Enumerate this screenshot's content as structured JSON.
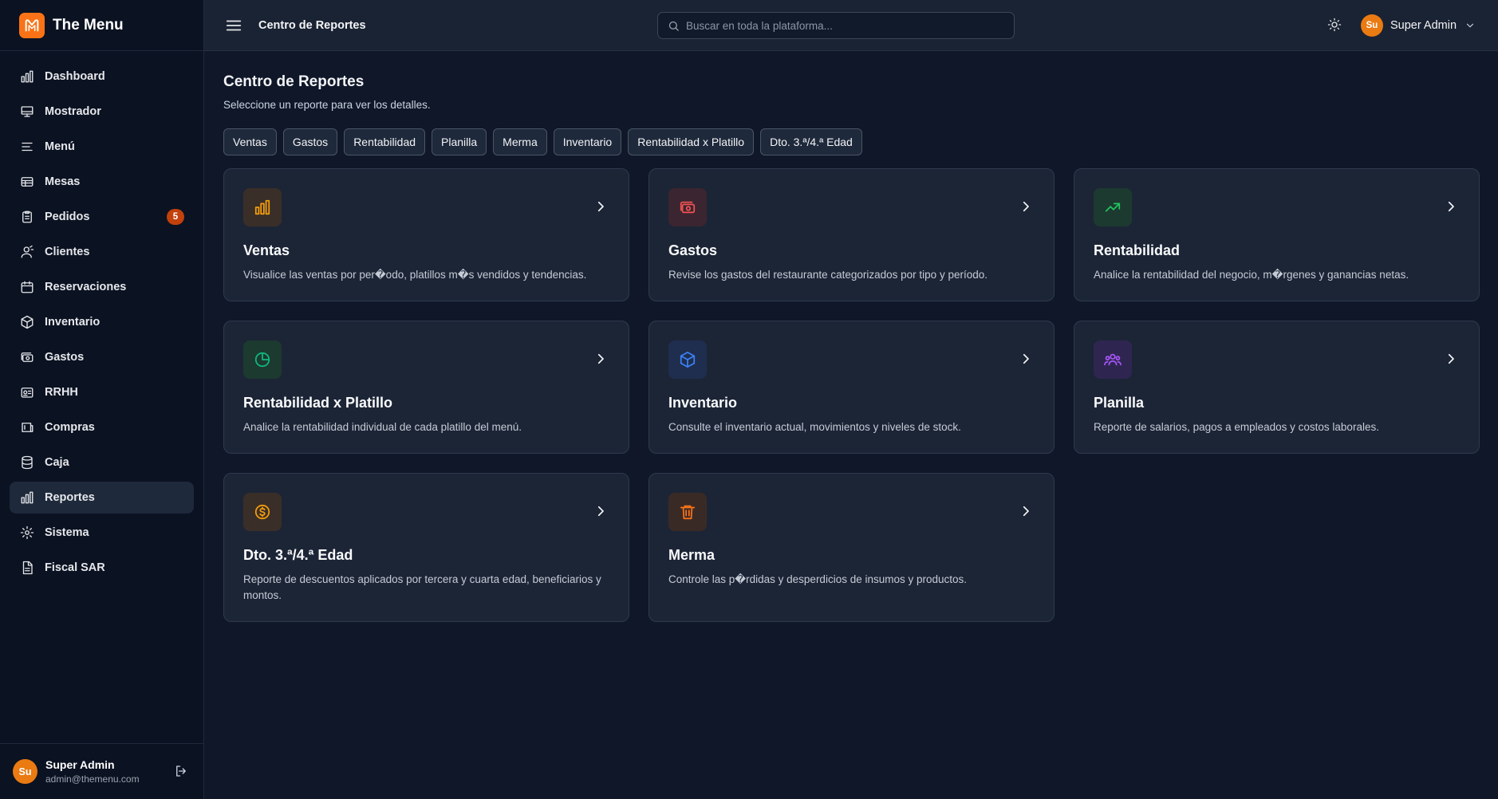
{
  "brand": {
    "name": "The Menu",
    "logo_icon": "the-menu-logo"
  },
  "sidebar": {
    "items": [
      {
        "label": "Dashboard",
        "icon": "bar-chart-icon"
      },
      {
        "label": "Mostrador",
        "icon": "monitor-icon"
      },
      {
        "label": "Menú",
        "icon": "menu-lines-icon"
      },
      {
        "label": "Mesas",
        "icon": "table-icon"
      },
      {
        "label": "Pedidos",
        "icon": "clipboard-icon",
        "badge": "5"
      },
      {
        "label": "Clientes",
        "icon": "users-icon"
      },
      {
        "label": "Reservaciones",
        "icon": "calendar-icon"
      },
      {
        "label": "Inventario",
        "icon": "box-icon"
      },
      {
        "label": "Gastos",
        "icon": "banknote-icon"
      },
      {
        "label": "RRHH",
        "icon": "id-card-icon"
      },
      {
        "label": "Compras",
        "icon": "cart-icon"
      },
      {
        "label": "Caja",
        "icon": "database-icon"
      },
      {
        "label": "Reportes",
        "icon": "bar-chart-icon",
        "active": true
      },
      {
        "label": "Sistema",
        "icon": "settings-icon"
      },
      {
        "label": "Fiscal SAR",
        "icon": "file-icon"
      }
    ],
    "user": {
      "initials": "Su",
      "name": "Super Admin",
      "email": "admin@themenu.com"
    }
  },
  "header": {
    "title": "Centro de Reportes",
    "search_placeholder": "Buscar en toda la plataforma...",
    "user": {
      "initials": "Su",
      "name": "Super Admin"
    }
  },
  "main": {
    "title": "Centro de Reportes",
    "subtitle": "Seleccione un reporte para ver los detalles.",
    "tabs": [
      "Ventas",
      "Gastos",
      "Rentabilidad",
      "Planilla",
      "Merma",
      "Inventario",
      "Rentabilidad x Platillo",
      "Dto. 3.ª/4.ª Edad"
    ],
    "cards": [
      {
        "title": "Ventas",
        "desc": "Visualice las ventas por per�odo, platillos m�s vendidos y tendencias.",
        "icon": "bar-chart-icon",
        "color": "#f59e0b",
        "bg": "#3a2e28"
      },
      {
        "title": "Gastos",
        "desc": "Revise los gastos del restaurante categorizados por tipo y período.",
        "icon": "banknote-icon",
        "color": "#f05252",
        "bg": "#3b2530"
      },
      {
        "title": "Rentabilidad",
        "desc": "Analice la rentabilidad del negocio, m�rgenes y ganancias netas.",
        "icon": "trending-up-icon",
        "color": "#22c55e",
        "bg": "#1c3a30"
      },
      {
        "title": "Rentabilidad x Platillo",
        "desc": "Analice la rentabilidad individual de cada platillo del menú.",
        "icon": "pie-chart-icon",
        "color": "#10b981",
        "bg": "#1c3a30"
      },
      {
        "title": "Inventario",
        "desc": "Consulte el inventario actual, movimientos y niveles de stock.",
        "icon": "box-icon",
        "color": "#3b82f6",
        "bg": "#1f2e4e"
      },
      {
        "title": "Planilla",
        "desc": "Reporte de salarios, pagos a empleados y costos laborales.",
        "icon": "users-icon",
        "color": "#a855f7",
        "bg": "#2e2650"
      },
      {
        "title": "Dto. 3.ª/4.ª Edad",
        "desc": "Reporte de descuentos aplicados por tercera y cuarta edad, beneficiarios y montos.",
        "icon": "coin-icon",
        "color": "#f59e0b",
        "bg": "#3a2e28"
      },
      {
        "title": "Merma",
        "desc": "Controle las p�rdidas y desperdicios de insumos y productos.",
        "icon": "trash-icon",
        "color": "#f97316",
        "bg": "#3a2a26"
      }
    ]
  }
}
